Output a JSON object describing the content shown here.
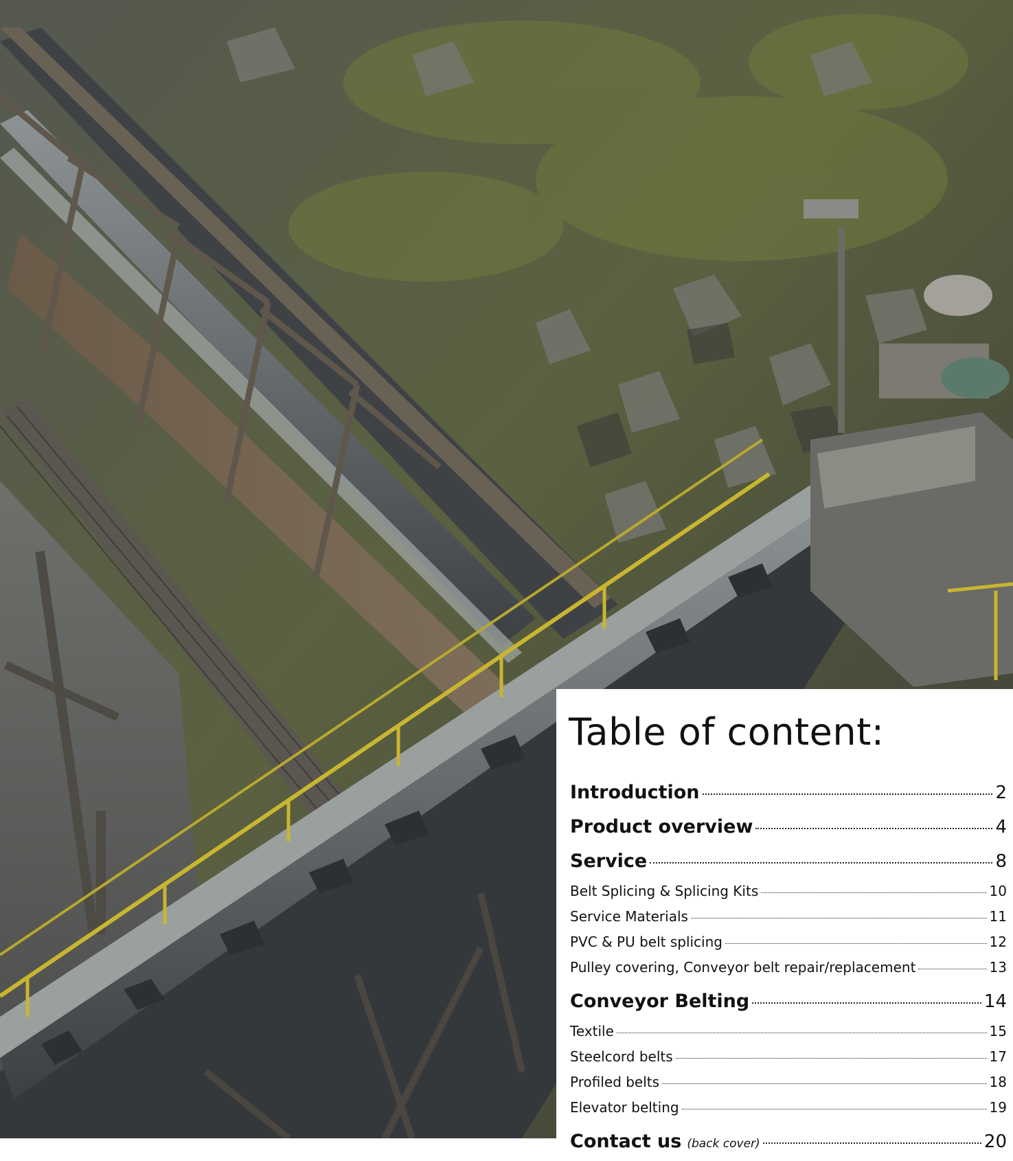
{
  "toc": {
    "title": "Table of content:",
    "entries": [
      {
        "label": "Introduction",
        "page": "2",
        "level": "main"
      },
      {
        "label": "Product overview",
        "page": "4",
        "level": "main"
      },
      {
        "label": "Service",
        "page": "8",
        "level": "main"
      },
      {
        "label": "Belt Splicing & Splicing Kits",
        "page": "10",
        "level": "sub"
      },
      {
        "label": "Service Materials",
        "page": "11",
        "level": "sub"
      },
      {
        "label": "PVC & PU belt splicing",
        "page": "12",
        "level": "sub"
      },
      {
        "label": "Pulley covering, Conveyor belt repair/replacement",
        "page": "13",
        "level": "sub"
      },
      {
        "label": "Conveyor Belting",
        "page": "14",
        "level": "main"
      },
      {
        "label": "Textile",
        "page": "15",
        "level": "sub"
      },
      {
        "label": "Steelcord belts",
        "page": "17",
        "level": "sub"
      },
      {
        "label": "Profiled belts",
        "page": "18",
        "level": "sub"
      },
      {
        "label": "Elevator belting",
        "page": "19",
        "level": "sub"
      },
      {
        "label": "Contact us",
        "note": "(back cover)",
        "page": "20",
        "level": "main"
      }
    ]
  }
}
